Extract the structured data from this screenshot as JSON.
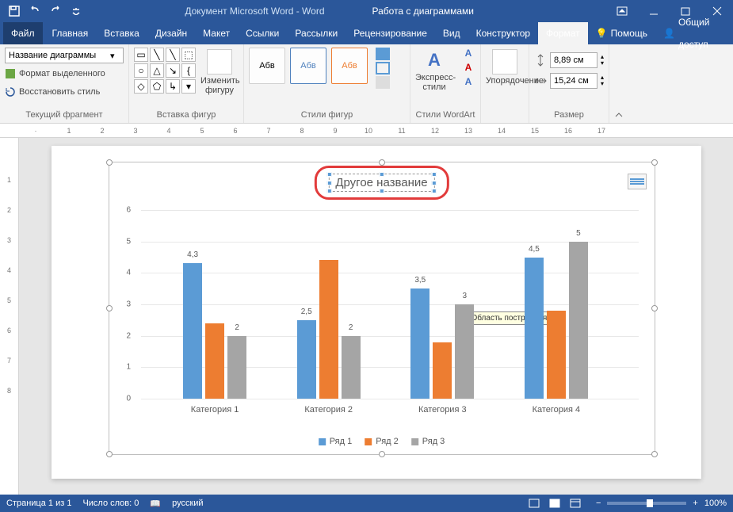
{
  "titlebar": {
    "doc_title": "Документ Microsoft Word - Word",
    "context_title": "Работа с диаграммами"
  },
  "tabs": {
    "file": "Файл",
    "items": [
      "Главная",
      "Вставка",
      "Дизайн",
      "Макет",
      "Ссылки",
      "Рассылки",
      "Рецензирование",
      "Вид",
      "Конструктор",
      "Формат"
    ],
    "active_index": 9,
    "help": "Помощь",
    "share": "Общий доступ"
  },
  "ribbon": {
    "g1": {
      "selector": "Название диаграммы",
      "format_sel": "Формат выделенного",
      "reset_style": "Восстановить стиль",
      "label": "Текущий фрагмент"
    },
    "g2": {
      "change_shape": "Изменить фигуру",
      "label": "Вставка фигур"
    },
    "g3": {
      "preview": "Абв",
      "label": "Стили фигур"
    },
    "g4": {
      "express": "Экспресс-стили",
      "label": "Стили WordArt"
    },
    "g5": {
      "arrange": "Упорядочение"
    },
    "g6": {
      "height": "8,89 см",
      "width": "15,24 см",
      "label": "Размер"
    }
  },
  "chart_data": {
    "type": "bar",
    "title": "Другое название",
    "categories": [
      "Категория 1",
      "Категория 2",
      "Категория 3",
      "Категория 4"
    ],
    "series": [
      {
        "name": "Ряд 1",
        "values": [
          4.3,
          2.5,
          3.5,
          4.5
        ],
        "color": "#5b9bd5"
      },
      {
        "name": "Ряд 2",
        "values": [
          2.4,
          4.4,
          1.8,
          2.8
        ],
        "color": "#ed7d31"
      },
      {
        "name": "Ряд 3",
        "values": [
          2,
          2,
          3,
          5
        ],
        "color": "#a5a5a5"
      }
    ],
    "data_labels": [
      [
        "4,3",
        "",
        "2"
      ],
      [
        "2,5",
        "",
        "2"
      ],
      [
        "3,5",
        "",
        "3"
      ],
      [
        "4,5",
        "",
        "5"
      ]
    ],
    "ylim": [
      0,
      6
    ],
    "yticks": [
      0,
      1,
      2,
      3,
      4,
      5,
      6
    ],
    "tooltip": "Область построения"
  },
  "statusbar": {
    "page": "Страница 1 из 1",
    "words": "Число слов: 0",
    "lang": "русский",
    "zoom": "100%"
  }
}
